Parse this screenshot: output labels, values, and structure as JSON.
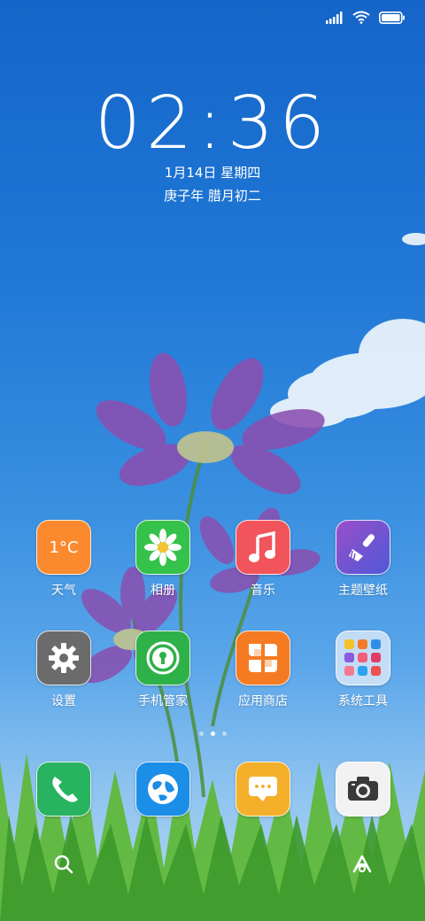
{
  "lockscreen_clock": {
    "time": "02:36",
    "date": "1月14日 星期四",
    "lunar": "庚子年 腊月初二"
  },
  "status_bar": {
    "icons": [
      "signal-icon",
      "wifi-icon",
      "battery-icon"
    ]
  },
  "home_grid": {
    "row1": [
      {
        "label": "天气",
        "icon": "weather-icon",
        "icon_text": "1°C",
        "color": "#fb8a2e"
      },
      {
        "label": "相册",
        "icon": "gallery-flower-icon",
        "color": "#35c24b"
      },
      {
        "label": "音乐",
        "icon": "music-note-icon",
        "color": "#f2545b"
      },
      {
        "label": "主题壁纸",
        "icon": "theme-brush-icon",
        "color": "#7a4fd6"
      }
    ],
    "row2": [
      {
        "label": "设置",
        "icon": "gear-icon",
        "color": "#6b6b6b"
      },
      {
        "label": "手机管家",
        "icon": "security-keyhole-icon",
        "color": "#2fb14a"
      },
      {
        "label": "应用商店",
        "icon": "app-store-icon",
        "color": "#f57b22"
      },
      {
        "label": "系统工具",
        "icon": "folder-icon",
        "color": "#d7e6f7"
      }
    ]
  },
  "page_indicator": {
    "pages": 3,
    "active": 1
  },
  "dock": [
    {
      "name": "phone",
      "icon": "phone-icon",
      "color": "#27b35f"
    },
    {
      "name": "browser",
      "icon": "globe-icon",
      "color": "#1b8ee8"
    },
    {
      "name": "messages",
      "icon": "message-icon",
      "color": "#f4b02a"
    },
    {
      "name": "camera",
      "icon": "camera-icon",
      "color": "#f2f2f2"
    }
  ],
  "bottom_bar": {
    "search_icon": "search-icon",
    "assistant_icon": "assistant-icon"
  }
}
